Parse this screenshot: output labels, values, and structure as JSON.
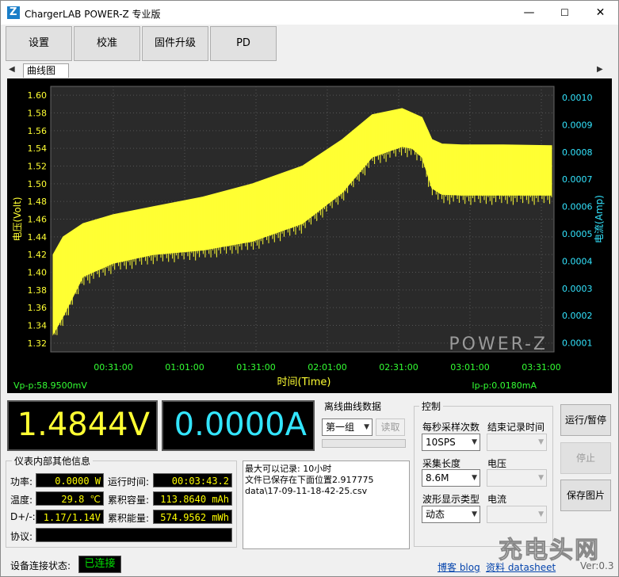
{
  "window": {
    "title": "ChargerLAB POWER-Z 专业版",
    "min": "—",
    "max": "☐",
    "close": "✕"
  },
  "toolbar": [
    {
      "label": "设置"
    },
    {
      "label": "校准"
    },
    {
      "label": "固件升级"
    },
    {
      "label": "PD"
    }
  ],
  "tabs": {
    "active": "曲线图",
    "left_arrow": "◀",
    "right_arrow": "▶"
  },
  "chart_data": {
    "type": "line",
    "xlabel": "时间(Time)",
    "ylabel_left": "电压(Volt)",
    "ylabel_right": "电流(Amp)",
    "x_ticks": [
      "00:31:00",
      "01:01:00",
      "01:31:00",
      "02:01:00",
      "02:31:00",
      "03:01:00",
      "03:31:00"
    ],
    "y_left_ticks": [
      "1.60",
      "1.58",
      "1.56",
      "1.54",
      "1.52",
      "1.50",
      "1.48",
      "1.46",
      "1.44",
      "1.42",
      "1.40",
      "1.38",
      "1.36",
      "1.34",
      "1.32"
    ],
    "y_right_ticks": [
      "0.0010",
      "0.0009",
      "0.0008",
      "0.0007",
      "0.0006",
      "0.0005",
      "0.0004",
      "0.0003",
      "0.0002",
      "0.0001"
    ],
    "ylim_left": [
      1.31,
      1.61
    ],
    "watermark": "POWER-Z",
    "vpp": "Vp-p:58.9500mV",
    "ipp": "Ip-p:0.0180mA",
    "series": [
      {
        "name": "电压(Volt)",
        "color": "#ffff33",
        "x_frac": [
          0.0,
          0.02,
          0.06,
          0.12,
          0.2,
          0.3,
          0.4,
          0.5,
          0.58,
          0.64,
          0.7,
          0.72,
          0.74,
          0.76,
          0.78,
          0.82,
          0.9,
          1.0
        ],
        "upper": [
          1.42,
          1.44,
          1.455,
          1.465,
          1.474,
          1.485,
          1.5,
          1.52,
          1.55,
          1.578,
          1.585,
          1.58,
          1.575,
          1.55,
          1.545,
          1.544,
          1.544,
          1.543
        ],
        "lower": [
          1.33,
          1.35,
          1.395,
          1.41,
          1.42,
          1.425,
          1.435,
          1.455,
          1.49,
          1.53,
          1.542,
          1.54,
          1.53,
          1.495,
          1.488,
          1.487,
          1.487,
          1.487
        ]
      }
    ]
  },
  "readouts": {
    "voltage": "1.4844V",
    "current": "0.0000A"
  },
  "offline": {
    "group_label": "离线曲线数据",
    "selected": "第一组",
    "read_button": "读取"
  },
  "control": {
    "group_label": "控制",
    "sample_rate_label": "每秒采样次数",
    "sample_rate_value": "10SPS",
    "end_time_label": "结束记录时间",
    "end_time_value": "",
    "length_label": "采集长度",
    "length_value": "8.6M",
    "voltage_label": "电压",
    "voltage_value": "",
    "waveform_label": "波形显示类型",
    "waveform_value": "动态",
    "current_label": "电流",
    "current_value": ""
  },
  "side_buttons": {
    "run_pause": "运行/暂停",
    "stop": "停止",
    "save_image": "保存图片"
  },
  "info": {
    "group_label": "仪表内部其他信息",
    "power_label": "功率:",
    "power_value": "0.0000 W",
    "runtime_label": "运行时间:",
    "runtime_value": "00:03:43.2",
    "temp_label": "温度:",
    "temp_value": "29.8 ℃",
    "capacity_label": "累积容量:",
    "capacity_value": "113.8640 mAh",
    "dpdm_label": "D+/-:",
    "dpdm_value": "1.17/1.14V",
    "energy_label": "累积能量:",
    "energy_value": "574.9562 mWh",
    "protocol_label": "协议:",
    "protocol_value": ""
  },
  "log": {
    "line1": "最大可以记录: 10小时",
    "line2": "文件已保存在下面位置2.917775",
    "line3": "data\\17-09-11-18-42-25.csv"
  },
  "status": {
    "label": "设备连接状态:",
    "value": "已连接"
  },
  "links": {
    "blog": "博客 blog",
    "datasheet": "资料 datasheet",
    "version": "Ver:0.3"
  },
  "brand_watermark": "充电头网"
}
